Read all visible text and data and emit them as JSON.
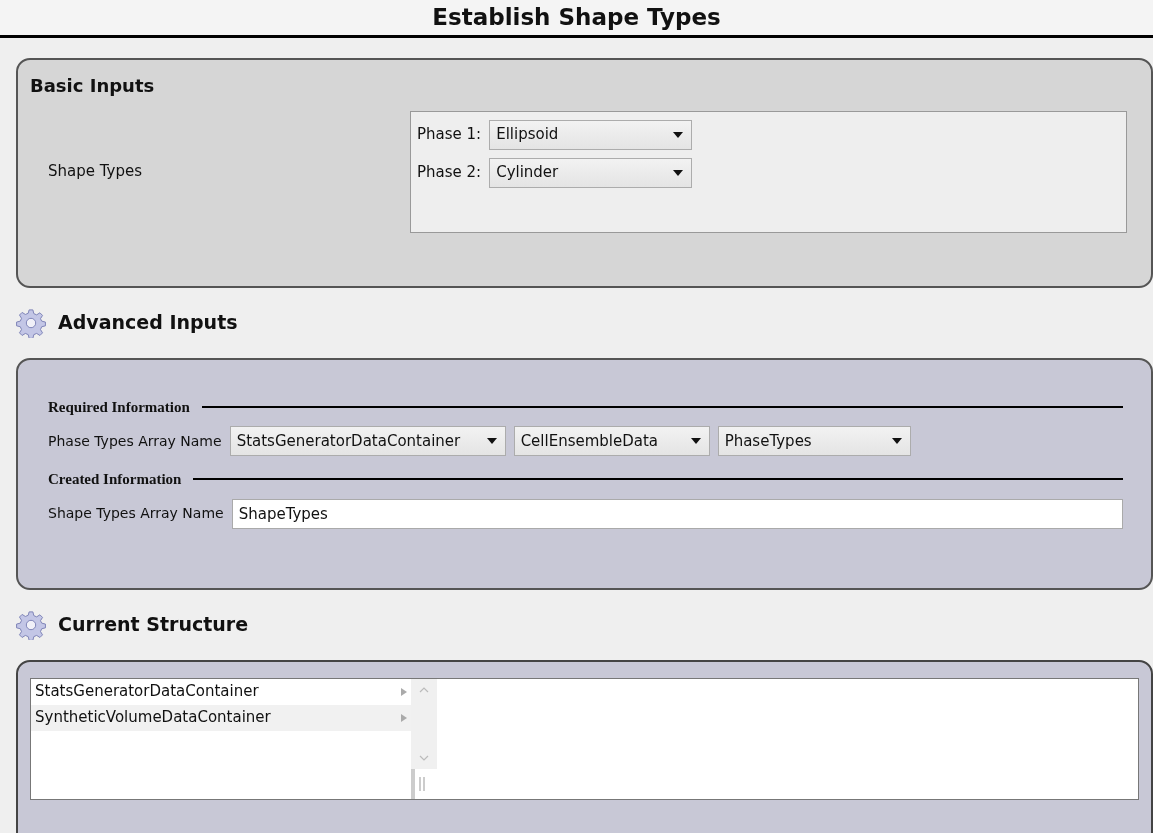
{
  "title": "Establish Shape Types",
  "basic_inputs": {
    "heading": "Basic Inputs",
    "label": "Shape Types",
    "phases": [
      {
        "label": "Phase 1:",
        "value": "Ellipsoid"
      },
      {
        "label": "Phase 2:",
        "value": "Cylinder"
      }
    ]
  },
  "advanced_inputs": {
    "heading": "Advanced Inputs",
    "required": {
      "heading": "Required Information",
      "label": "Phase Types Array Name",
      "selects": [
        "StatsGeneratorDataContainer",
        "CellEnsembleData",
        "PhaseTypes"
      ]
    },
    "created": {
      "heading": "Created Information",
      "label": "Shape Types Array Name",
      "value": "ShapeTypes"
    }
  },
  "current_structure": {
    "heading": "Current Structure",
    "items": [
      {
        "label": "StatsGeneratorDataContainer"
      },
      {
        "label": "SyntheticVolumeDataContainer"
      }
    ]
  }
}
